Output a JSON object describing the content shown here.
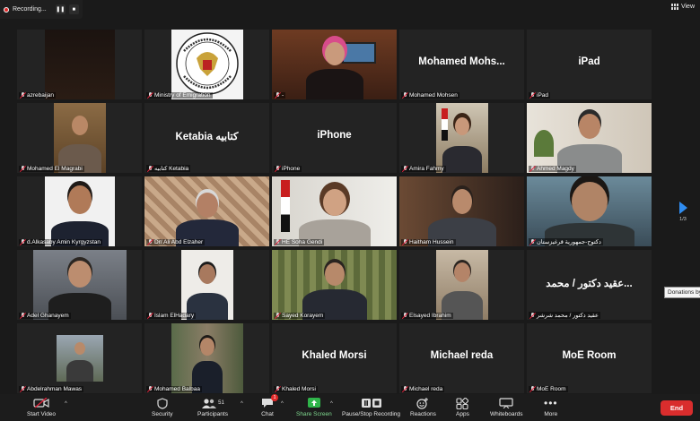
{
  "recording": {
    "label": "Recording..."
  },
  "view": {
    "label": "View"
  },
  "tiles": [
    {
      "name": "azrebaijan",
      "text": ""
    },
    {
      "name": "Ministry of Emigration",
      "text": ""
    },
    {
      "name": "-",
      "text": ""
    },
    {
      "name": "Mohamed Mohsen",
      "text": "Mohamed  Mohs..."
    },
    {
      "name": "iPad",
      "text": "iPad"
    },
    {
      "name": "Mohamed El Magrabi",
      "text": ""
    },
    {
      "name": "كتابيه Ketabia",
      "text": "Ketabia كتابيه"
    },
    {
      "name": "iPhone",
      "text": "iPhone"
    },
    {
      "name": "Amira Fahmy",
      "text": ""
    },
    {
      "name": "Ahmed Magdy",
      "text": ""
    },
    {
      "name": "d.Alkasaby Amin Kyrgyzstan",
      "text": ""
    },
    {
      "name": "Dr/ Ali Abd Elzaher",
      "text": ""
    },
    {
      "name": "HE Soha Gendi",
      "text": ""
    },
    {
      "name": "Haitham Hussein",
      "text": ""
    },
    {
      "name": "دكتوح-جمهورية قرغيزستان",
      "text": ""
    },
    {
      "name": "Adel Ghanayem",
      "text": ""
    },
    {
      "name": "Islam ElHadary",
      "text": ""
    },
    {
      "name": "Sayed Korayem",
      "text": ""
    },
    {
      "name": "Elsayed Ibrahim",
      "text": ""
    },
    {
      "name": "عقيد دكتور / محمد شرشر",
      "text": "عقيد دكتور / محمد..."
    },
    {
      "name": "Abdelrahman Mawas",
      "text": ""
    },
    {
      "name": "Mohamed Balbaa",
      "text": ""
    },
    {
      "name": "Khaled Morsi",
      "text": "Khaled Morsi"
    },
    {
      "name": "Michael reda",
      "text": "Michael reda"
    },
    {
      "name": "MoE Room",
      "text": "MoE Room"
    }
  ],
  "pager": {
    "count": "1/3"
  },
  "tooltip": {
    "text": "Donations by"
  },
  "toolbar": {
    "start_video": "Start Video",
    "security": "Security",
    "participants": "Participants",
    "participants_count": "51",
    "chat": "Chat",
    "chat_badge": "1",
    "share_screen": "Share Screen",
    "recording": "Pause/Stop Recording",
    "reactions": "Reactions",
    "apps": "Apps",
    "whiteboards": "Whiteboards",
    "more": "More",
    "end": "End"
  },
  "colors": {
    "active_border": "#8ed24a",
    "end": "#d92d2d",
    "share": "#2fb54a",
    "accent": "#2f8cf0"
  }
}
